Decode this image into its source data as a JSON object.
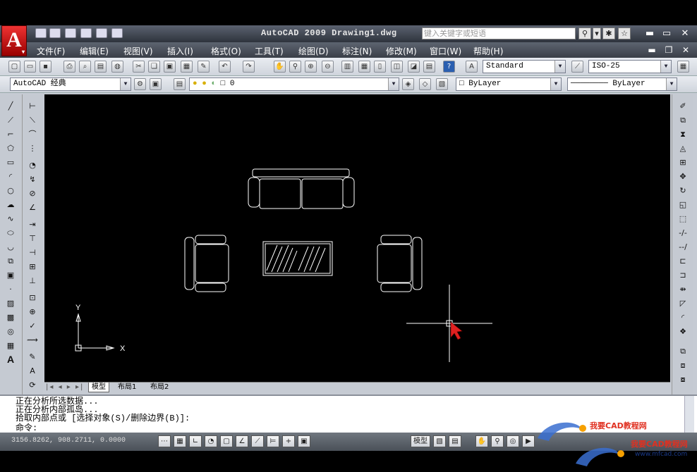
{
  "title_bar": {
    "app_title": "AutoCAD 2009  Drawing1.dwg",
    "search_placeholder": "键入关键字或短语",
    "logo": "A"
  },
  "menu": [
    "文件(F)",
    "编辑(E)",
    "视图(V)",
    "插入(I)",
    "格式(O)",
    "工具(T)",
    "绘图(D)",
    "标注(N)",
    "修改(M)",
    "窗口(W)",
    "帮助(H)"
  ],
  "toolbar": {
    "text_style": "Standard",
    "dim_style": "ISO-25",
    "workspace": "AutoCAD 经典",
    "layer": "0",
    "color": "ByLayer",
    "linetype": "ByLayer"
  },
  "axes": {
    "x": "X",
    "y": "Y"
  },
  "layout_tabs": [
    "模型",
    "布局1",
    "布局2"
  ],
  "command_lines": [
    "正在分析所选数据...",
    "正在分析内部孤岛...",
    "拾取内部点或 [选择对象(S)/删除边界(B)]:",
    "命令:"
  ],
  "status": {
    "coords": "3156.8262, 908.2711, 0.0000",
    "model_label": "模型"
  },
  "watermark": {
    "text": "我要CAD教程网",
    "url": "www.mfcad.com"
  },
  "colors": {
    "canvas": "#000000",
    "drawing": "#ffffff",
    "cursor": "#e02020"
  }
}
